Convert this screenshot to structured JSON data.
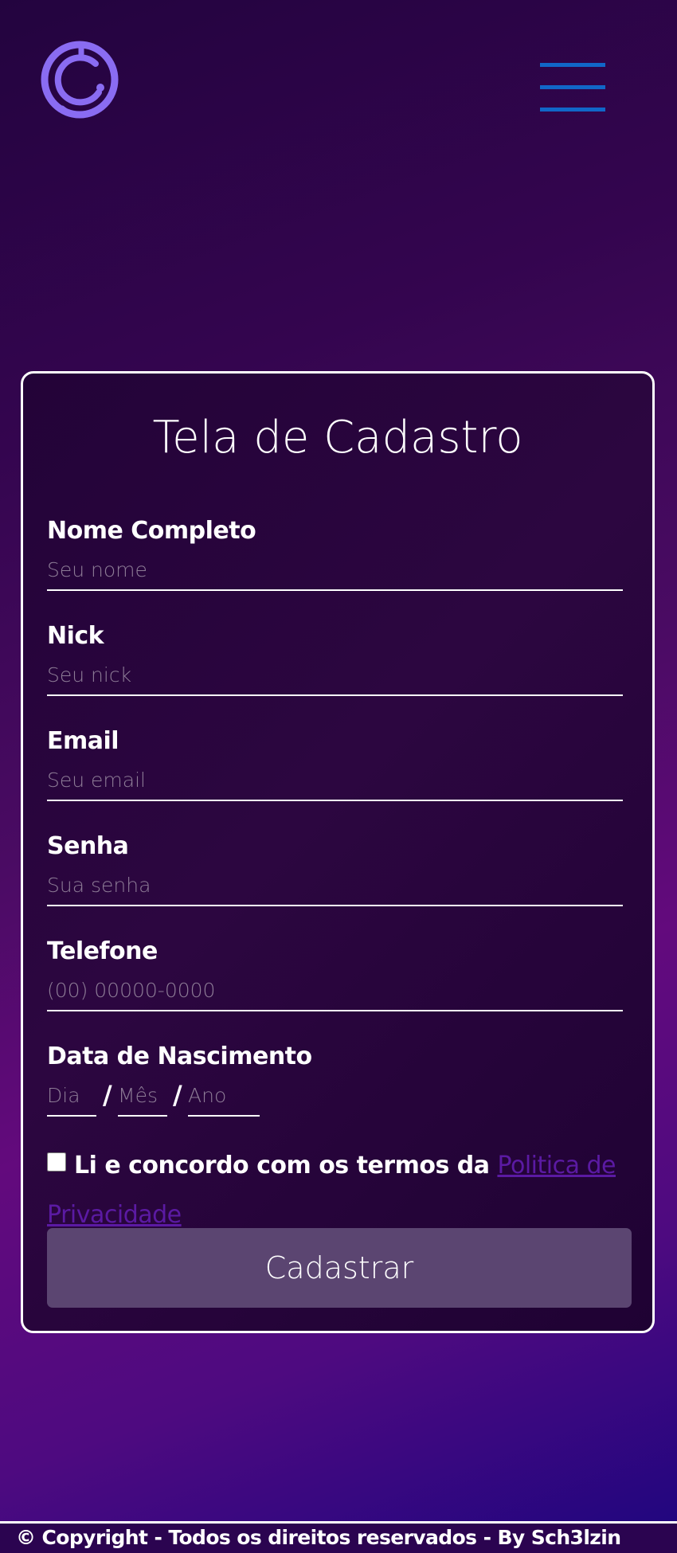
{
  "header": {
    "logo_icon": "circular-c-logo-icon",
    "menu_icon": "hamburger-menu-icon",
    "logo_color": "#8a6cf2",
    "menu_color": "#1167c8"
  },
  "form": {
    "title": "Tela de Cadastro",
    "fields": [
      {
        "label": "Nome Completo",
        "placeholder": "Seu nome",
        "value": ""
      },
      {
        "label": "Nick",
        "placeholder": "Seu nick",
        "value": ""
      },
      {
        "label": "Email",
        "placeholder": "Seu email",
        "value": ""
      },
      {
        "label": "Senha",
        "placeholder": "Sua senha",
        "value": ""
      },
      {
        "label": "Telefone",
        "placeholder": "(00) 00000-0000",
        "value": ""
      }
    ],
    "birthdate": {
      "label": "Data de Nascimento",
      "day_placeholder": "Dia",
      "month_placeholder": "Mês",
      "year_placeholder": "Ano",
      "separator": "/"
    },
    "terms": {
      "text": "Li e concordo com os termos da",
      "link_text": "Politica de Privacidade",
      "checked": false
    },
    "submit_label": "Cadastrar"
  },
  "footer": {
    "text": "© Copyright - Todos os direitos reservados - By Sch3lzin"
  },
  "colors": {
    "accent": "#8a6cf2",
    "button_bg": "#5b4571",
    "link": "#5b1aa3"
  }
}
